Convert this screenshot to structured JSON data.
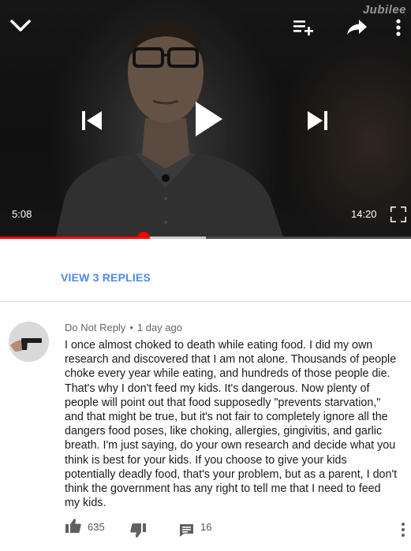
{
  "player": {
    "watermark": "Jubilee",
    "current_time": "5:08",
    "total_time": "14:20",
    "progress_played_fraction": 0.35,
    "progress_buffered_fraction": 0.5,
    "icons": {
      "collapse": "chevron-down-icon",
      "add_to_playlist": "add-to-playlist-icon",
      "share": "share-icon",
      "more": "more-vert-icon",
      "previous": "skip-previous-icon",
      "play": "play-icon",
      "next": "skip-next-icon",
      "fullscreen": "fullscreen-icon"
    }
  },
  "replies": {
    "view_label": "VIEW 3 REPLIES"
  },
  "comment": {
    "author": "Do Not Reply",
    "separator": "•",
    "time": "1 day ago",
    "text": "I once almost choked to death while eating food. I did my own research and discovered that I am not alone. Thousands of people choke every year while eating, and hundreds of those people die. That's why I don't feed my kids. It's dangerous. Now plenty of people will point out that food supposedly \"prevents starvation,\" and that might be true, but it's not fair to completely ignore all the dangers food poses, like choking, allergies, gingivitis, and garlic breath. I'm just saying, do your own research and decide what you think is best for your kids. If you choose to give your kids potentially deadly food, that's your problem, but as a parent, I don't think the government has any right to tell me that I need to feed my kids.",
    "likes": "635",
    "replies_count": "16"
  },
  "colors": {
    "progress_played": "#ff0000",
    "link_blue": "#4d8ae8",
    "text_primary": "#1a1a1a",
    "text_secondary": "#666666"
  }
}
